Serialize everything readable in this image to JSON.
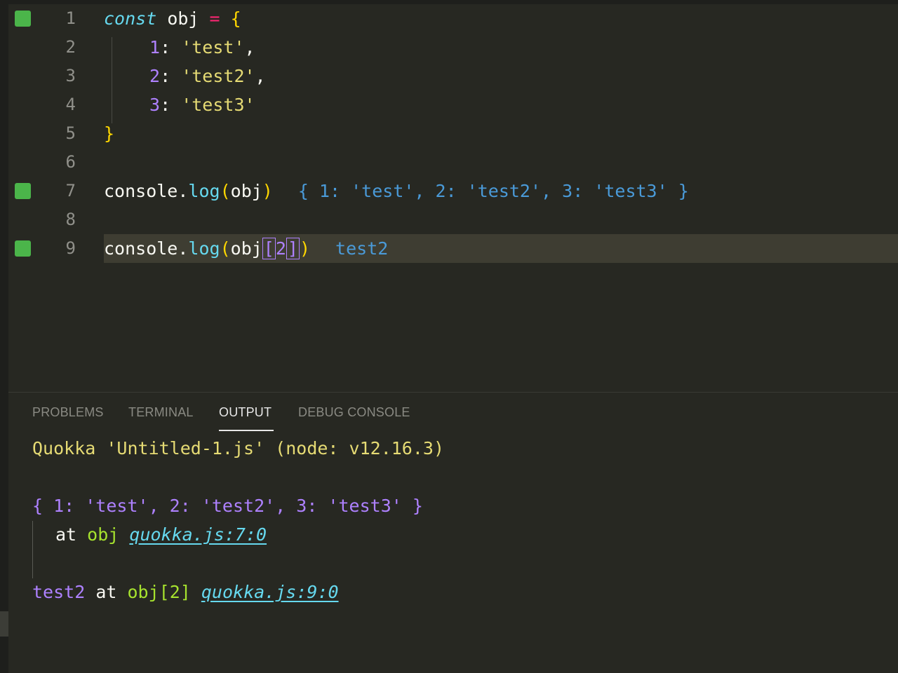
{
  "editor": {
    "lines": [
      {
        "number": "1"
      },
      {
        "number": "2"
      },
      {
        "number": "3"
      },
      {
        "number": "4"
      },
      {
        "number": "5"
      },
      {
        "number": "6"
      },
      {
        "number": "7"
      },
      {
        "number": "8"
      },
      {
        "number": "9"
      }
    ],
    "tokens": {
      "const": "const",
      "obj": "obj",
      "eq": "=",
      "lbrace": "{",
      "rbrace": "}",
      "k1": "1",
      "k2": "2",
      "k3": "3",
      "colon": ":",
      "s_test": "'test'",
      "s_test2": "'test2'",
      "s_test3": "'test3'",
      "comma": ",",
      "console": "console",
      "dot": ".",
      "log": "log",
      "lparen": "(",
      "rparen": ")",
      "lbracket": "[",
      "rbracket": "]"
    },
    "inline_results": {
      "line7": "{ 1: 'test', 2: 'test2', 3: 'test3' }",
      "line9": "test2"
    },
    "gutter_marker_color": "#4bb54a",
    "coverage_lines": [
      "1",
      "7",
      "9"
    ]
  },
  "panel": {
    "tabs": [
      {
        "label": "PROBLEMS"
      },
      {
        "label": "TERMINAL"
      },
      {
        "label": "OUTPUT",
        "active": true
      },
      {
        "label": "DEBUG CONSOLE"
      }
    ],
    "output": {
      "title": "Quokka 'Untitled-1.js' (node: v12.16.3)",
      "entry1_value": "{ 1: 'test', 2: 'test2', 3: 'test3' }",
      "entry1_at": "at",
      "entry1_expr": "obj",
      "entry1_link": "quokka.js:7:0",
      "entry2_value": "test2",
      "entry2_at": "at",
      "entry2_expr": "obj[2]",
      "entry2_link": "quokka.js:9:0"
    }
  },
  "colors": {
    "background": "#272822",
    "keyword": "#66d9ef",
    "string": "#e6db74",
    "number": "#ae81ff",
    "operator": "#f92672",
    "bracket": "#ffd700",
    "inline_result": "#4a9ad8",
    "link": "#66d9ef",
    "green": "#a6e22e"
  }
}
